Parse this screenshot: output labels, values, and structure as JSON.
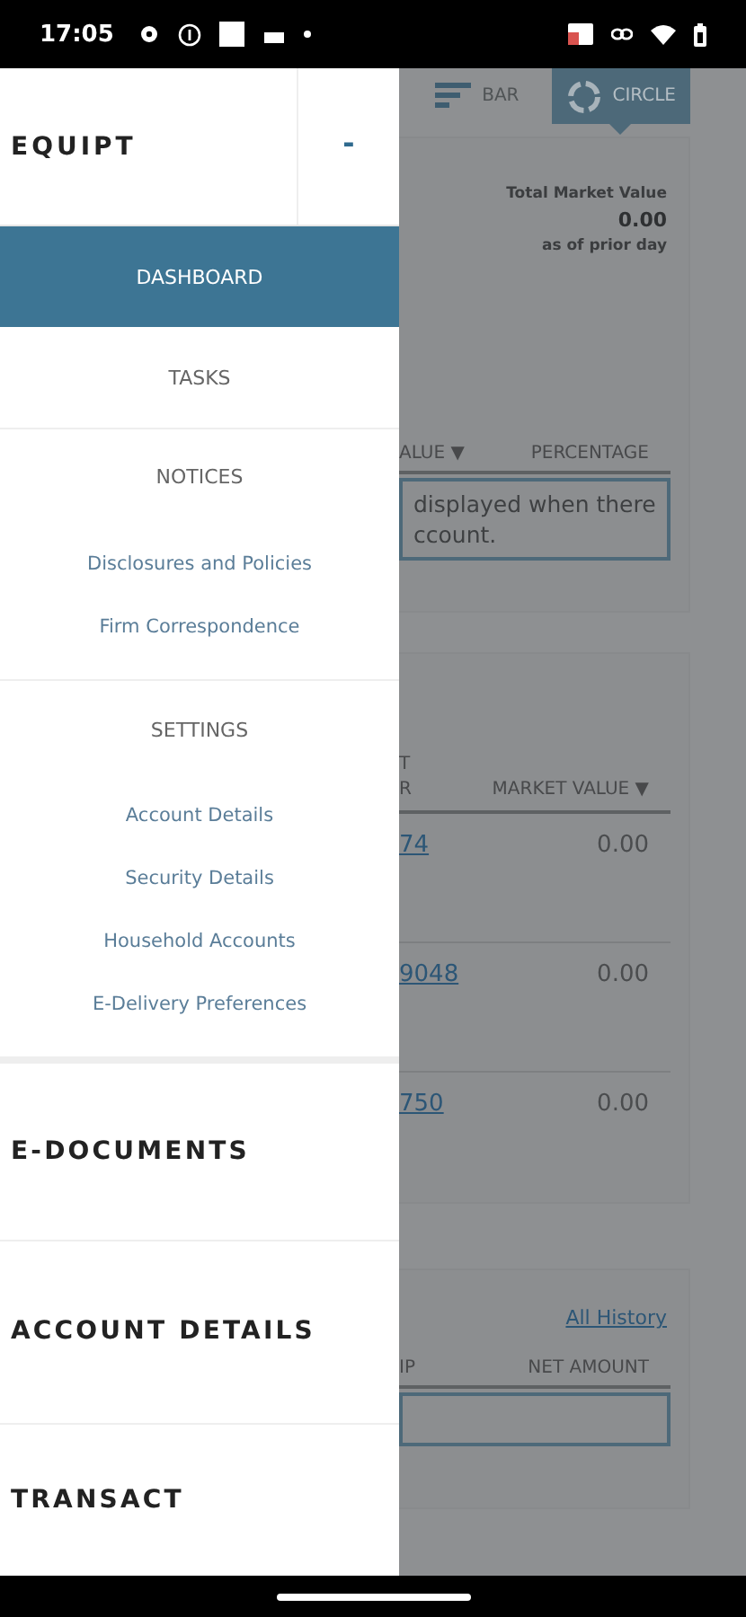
{
  "status_bar": {
    "time": "17:05"
  },
  "drawer": {
    "title": "EQUIPT",
    "toggle": "-",
    "items": [
      {
        "kind": "item",
        "label": "DASHBOARD",
        "selected": true
      },
      {
        "kind": "item",
        "label": "TASKS",
        "selected": false
      },
      {
        "kind": "item",
        "label": "NOTICES",
        "selected": false
      },
      {
        "kind": "link",
        "label": "Disclosures and Policies"
      },
      {
        "kind": "link",
        "label": "Firm Correspondence"
      },
      {
        "kind": "item",
        "label": "SETTINGS",
        "selected": false
      },
      {
        "kind": "link",
        "label": "Account Details"
      },
      {
        "kind": "link",
        "label": "Security Details"
      },
      {
        "kind": "link",
        "label": "Household Accounts"
      },
      {
        "kind": "link",
        "label": "E-Delivery Preferences"
      },
      {
        "kind": "group",
        "label": "E-DOCUMENTS"
      },
      {
        "kind": "group",
        "label": "ACCOUNT DETAILS"
      },
      {
        "kind": "group",
        "label": "TRANSACT"
      }
    ]
  },
  "background": {
    "view_toggle": [
      {
        "label": "BAR",
        "selected": false
      },
      {
        "label": "CIRCLE",
        "selected": true
      }
    ],
    "summary": {
      "label": "Total Market Value",
      "value": "0.00",
      "note": "as of prior day"
    },
    "allocation": {
      "columns": [
        "ALUE ▼",
        "PERCENTAGE"
      ],
      "message": [
        "displayed when there",
        "ccount."
      ]
    },
    "holdings": {
      "columns": [
        [
          "T",
          "R"
        ],
        [
          "MARKET VALUE ▼"
        ]
      ],
      "rows": [
        {
          "account": "74",
          "value": "0.00"
        },
        {
          "account": "9048",
          "value": "0.00"
        },
        {
          "account": "750",
          "value": "0.00"
        }
      ]
    },
    "activity": {
      "link": "All History",
      "columns": [
        "IP",
        "NET AMOUNT"
      ]
    }
  }
}
